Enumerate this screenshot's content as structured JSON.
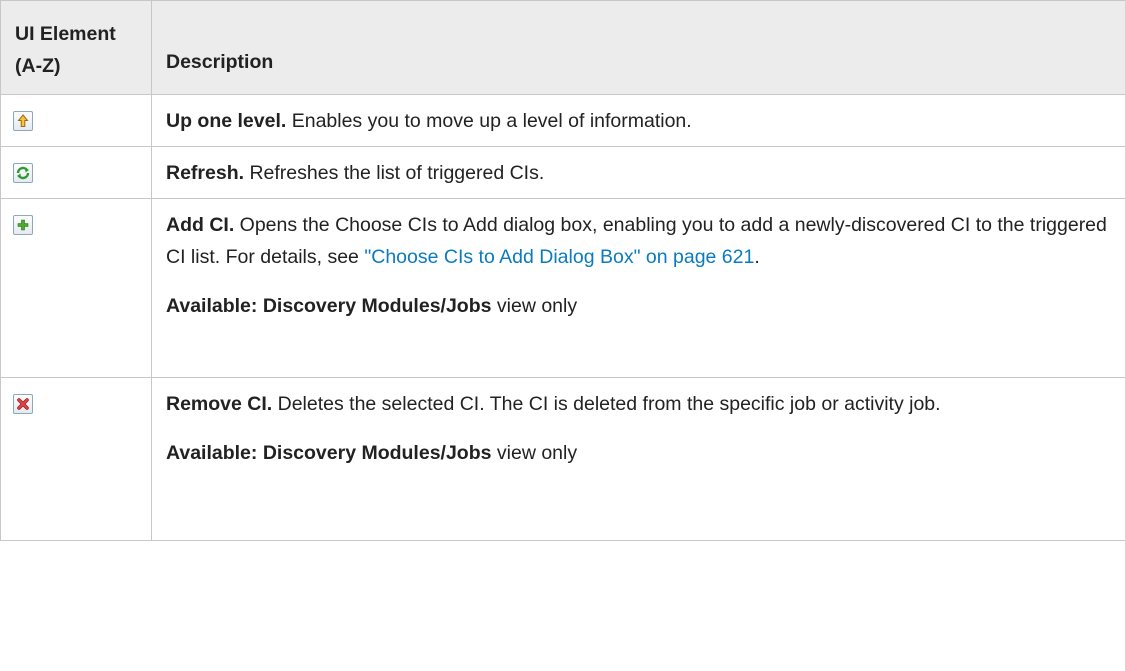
{
  "table": {
    "headers": {
      "element": "UI Element (A-Z)",
      "description": "Description"
    },
    "rows": [
      {
        "icon": "up-one-level-icon",
        "title": "Up one level.",
        "text": " Enables you to move up a level of information."
      },
      {
        "icon": "refresh-icon",
        "title": "Refresh.",
        "text": " Refreshes the list of triggered CIs."
      },
      {
        "icon": "add-icon",
        "title": "Add CI.",
        "text": " Opens the Choose CIs to Add dialog box, enabling you to add a newly-discovered CI to the triggered CI list. For details, see ",
        "link": "\"Choose CIs to Add Dialog Box\" on page 621",
        "text_after": ".",
        "available_label": "Available: Discovery Modules/Jobs",
        "available_suffix": " view only"
      },
      {
        "icon": "remove-icon",
        "title": "Remove CI.",
        "text": " Deletes the selected CI. The CI is deleted from the specific job or activity job.",
        "available_label": "Available: Discovery Modules/Jobs",
        "available_suffix": " view only"
      }
    ]
  },
  "colors": {
    "link": "#0a7bbf",
    "header_bg": "#ececec",
    "border": "#c7c7c7"
  }
}
